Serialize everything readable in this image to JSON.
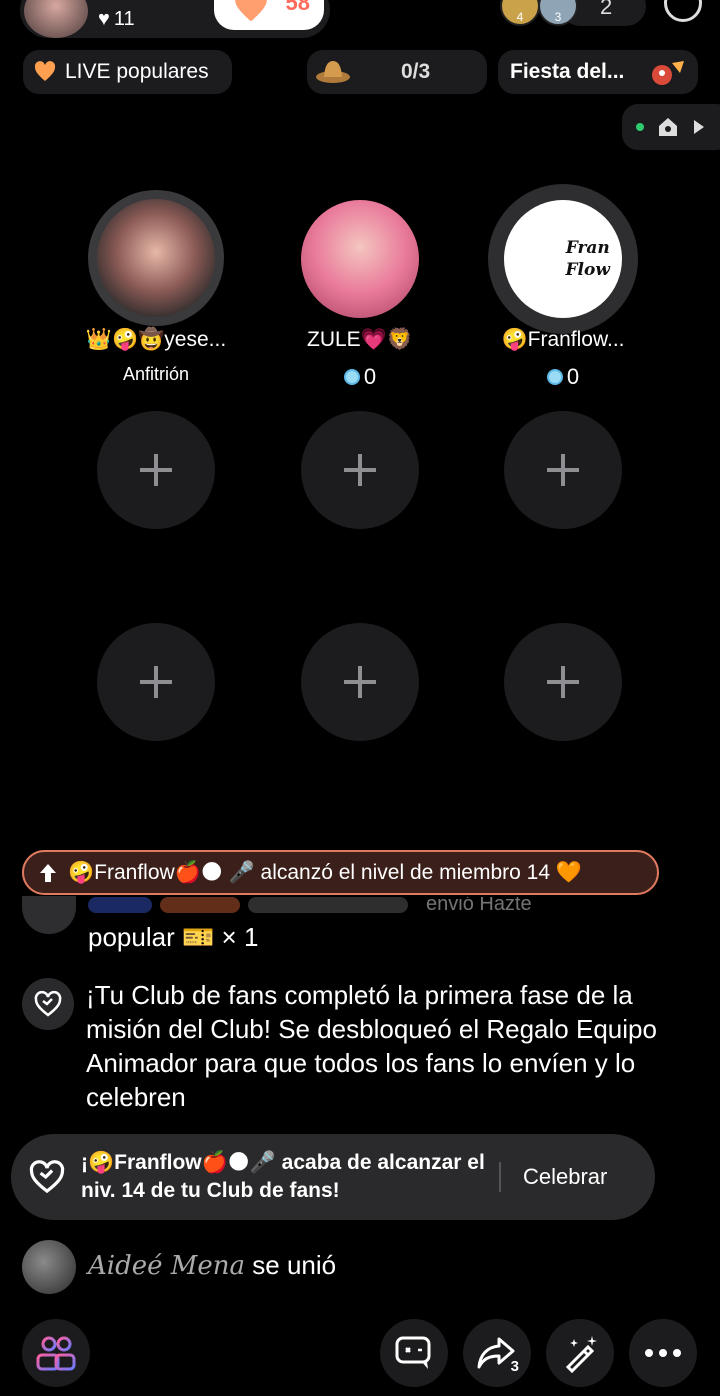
{
  "header": {
    "likes": "11",
    "follow_count": "58",
    "viewer_badges": [
      "4",
      "3"
    ],
    "viewer_count": "2"
  },
  "row2": {
    "live_populares": "LIVE populares",
    "quest_count": "0/3",
    "fiesta": "Fiesta del..."
  },
  "seats": [
    {
      "name": "👑🤪🤠yese...",
      "sub": "Anfitrión"
    },
    {
      "name": "ZULE💗🦁",
      "score": "0"
    },
    {
      "name": "🤪Franflow...",
      "score": "0"
    }
  ],
  "guest_avatar_text": [
    "Fran",
    "Flow"
  ],
  "chat": {
    "level_banner": "🤪Franflow🍎🌑 🎤 alcanzó el nivel de miembro 14 🧡",
    "faded_line": "envió Hazte",
    "gift_line": "popular 🎫 × 1",
    "club_message": "¡Tu Club de fans completó la primera fase de la misión del Club! Se desbloqueó el Regalo Equipo Animador para que todos los fans lo envíen y lo celebren",
    "toast_text": "¡🤪Franflow🍎🌑🎤 acaba de alcanzar el niv. 14 de tu Club de fans!",
    "toast_button": "Celebrar",
    "joined_name": "Aideé Mena",
    "joined_suffix": " se unió"
  },
  "bottom": {
    "share_count": "3"
  },
  "colors": {
    "accent": "#ff6a5a",
    "banner_border": "#e07a5f",
    "gem": "#5cb8e6"
  }
}
